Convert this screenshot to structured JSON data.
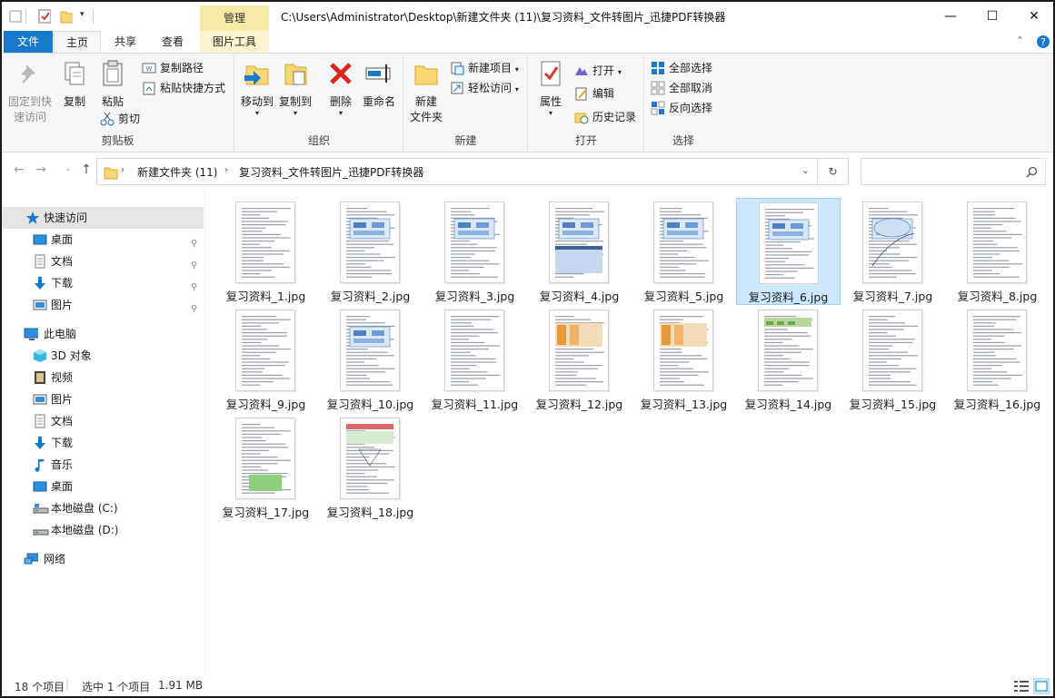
{
  "titlebar": {
    "path": "C:\\Users\\Administrator\\Desktop\\新建文件夹 (11)\\复习资料_文件转图片_迅捷PDF转换器",
    "context_tab": "管理",
    "minimize": "—",
    "maximize": "☐",
    "close": "✕"
  },
  "tabs": {
    "file": "文件",
    "home": "主页",
    "share": "共享",
    "view": "查看",
    "picture_tools": "图片工具"
  },
  "ribbon": {
    "clipboard": {
      "label": "剪贴板",
      "pin": "固定到快速访问",
      "pin_line1": "固定到快",
      "pin_line2": "速访问",
      "copy": "复制",
      "paste": "粘贴",
      "copy_path": "复制路径",
      "paste_shortcut": "粘贴快捷方式",
      "cut": "剪切"
    },
    "organize": {
      "label": "组织",
      "move_to": "移动到",
      "copy_to": "复制到",
      "delete": "删除",
      "rename": "重命名"
    },
    "new": {
      "label": "新建",
      "new_folder_l1": "新建",
      "new_folder_l2": "文件夹",
      "new_item": "新建项目",
      "easy_access": "轻松访问"
    },
    "open": {
      "label": "打开",
      "properties": "属性",
      "open": "打开",
      "edit": "编辑",
      "history": "历史记录"
    },
    "select": {
      "label": "选择",
      "select_all": "全部选择",
      "select_none": "全部取消",
      "invert": "反向选择"
    }
  },
  "nav": {
    "breadcrumb_1": "新建文件夹 (11)",
    "breadcrumb_2": "复习资料_文件转图片_迅捷PDF转换器",
    "search_placeholder": ""
  },
  "sidebar": {
    "quick_access": "快速访问",
    "qa_items": [
      "桌面",
      "文档",
      "下载",
      "图片"
    ],
    "this_pc": "此电脑",
    "pc_items": [
      "3D 对象",
      "视频",
      "图片",
      "文档",
      "下载",
      "音乐",
      "桌面",
      "本地磁盘 (C:)",
      "本地磁盘 (D:)"
    ],
    "network": "网络"
  },
  "files": [
    "复习资料_1.jpg",
    "复习资料_2.jpg",
    "复习资料_3.jpg",
    "复习资料_4.jpg",
    "复习资料_5.jpg",
    "复习资料_6.jpg",
    "复习资料_7.jpg",
    "复习资料_8.jpg",
    "复习资料_9.jpg",
    "复习资料_10.jpg",
    "复习资料_11.jpg",
    "复习资料_12.jpg",
    "复习资料_13.jpg",
    "复习资料_14.jpg",
    "复习资料_15.jpg",
    "复习资料_16.jpg",
    "复习资料_17.jpg",
    "复习资料_18.jpg"
  ],
  "selected_file_index": 5,
  "status": {
    "count": "18 个项目",
    "selection": "选中 1 个项目",
    "size": "1.91 MB"
  },
  "colors": {
    "accent": "#1979ca",
    "selection": "#cce8ff",
    "context_tab": "#f7e9a6"
  }
}
